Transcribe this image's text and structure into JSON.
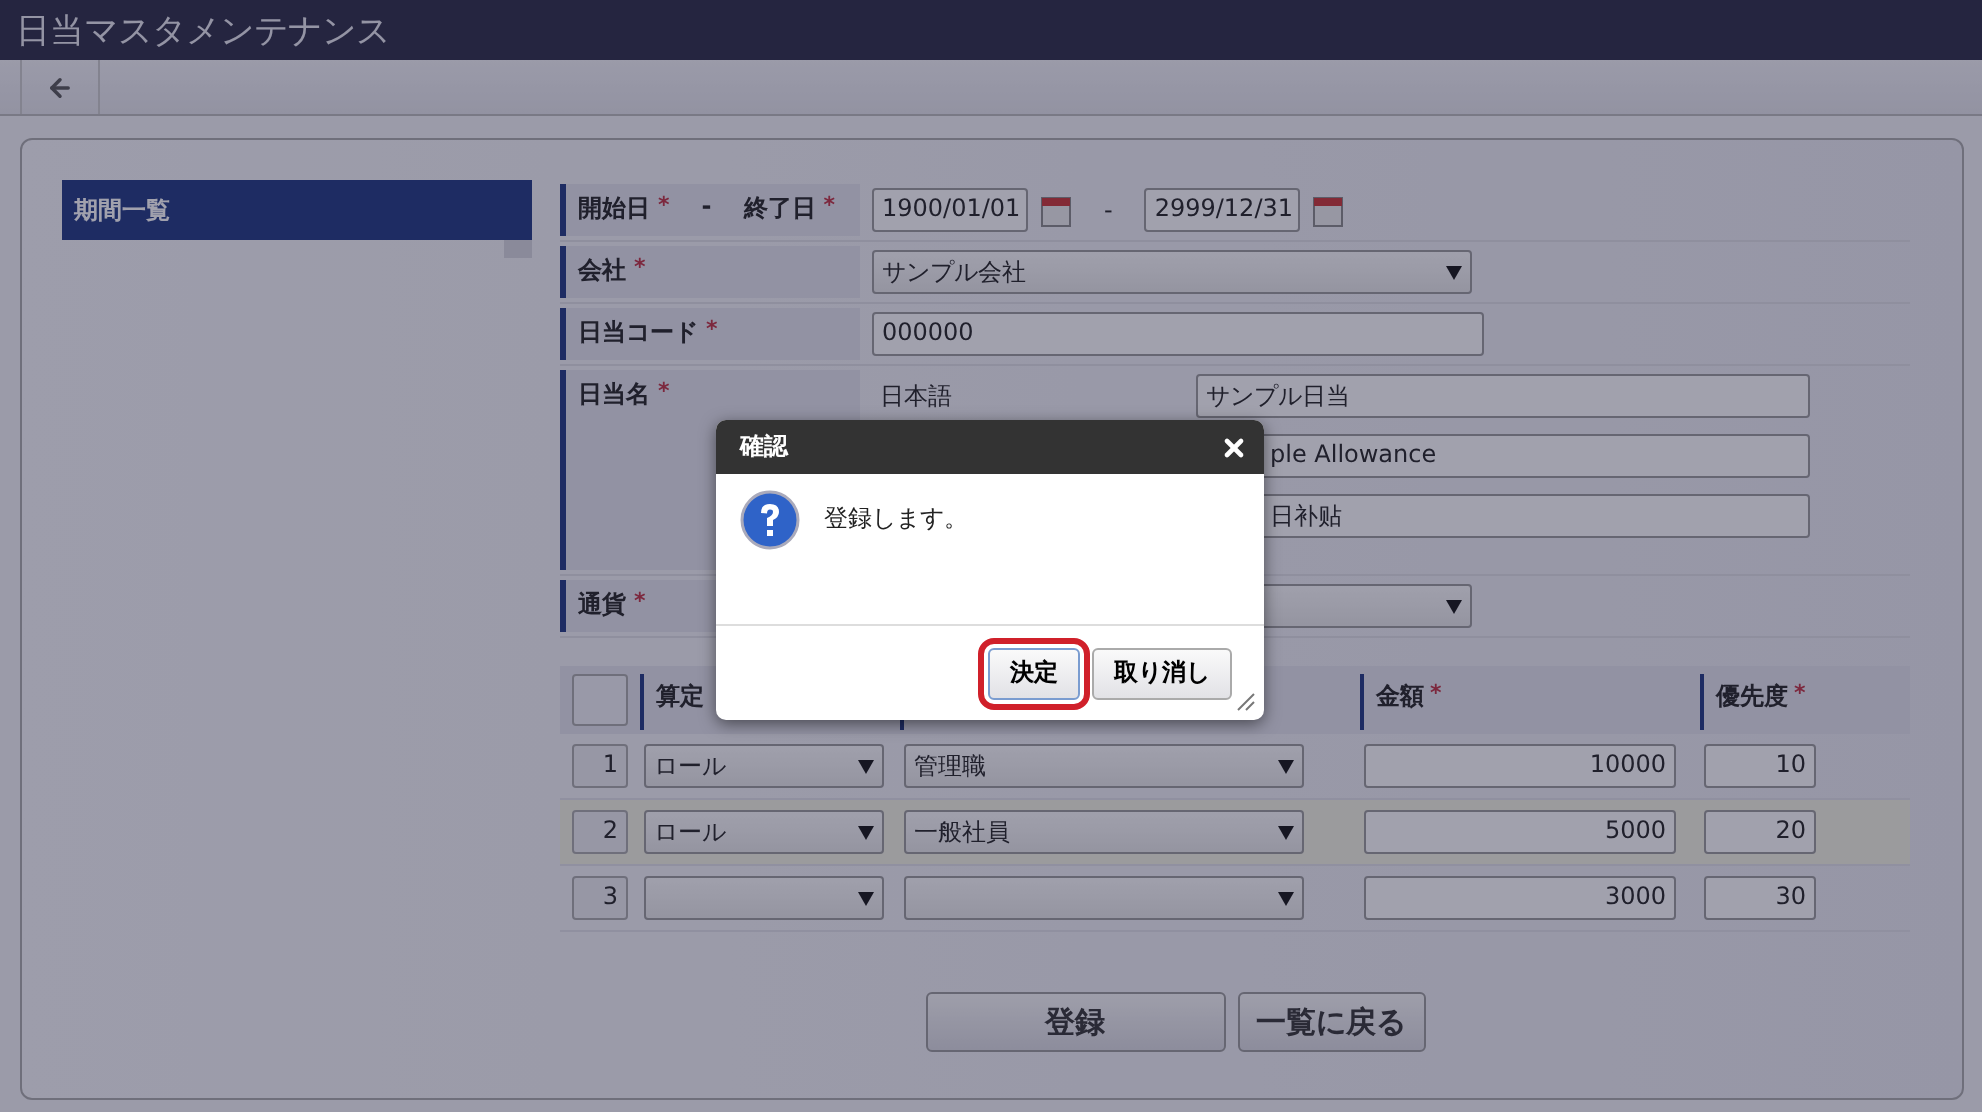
{
  "window": {
    "title": "日当マスタメンテナンス"
  },
  "sidebar": {
    "items": [
      {
        "label": "期間一覧",
        "selected": true
      }
    ]
  },
  "form": {
    "rows": [
      {
        "kind": "date_range",
        "labels": [
          {
            "text": "開始日",
            "mark": "*"
          },
          {
            "text": "終了日",
            "mark": "*"
          }
        ],
        "label_separator": "-",
        "start": "1900/01/01",
        "range_separator": "-",
        "end": "2999/12/31"
      },
      {
        "kind": "select",
        "labels": [
          {
            "text": "会社",
            "mark": "*"
          }
        ],
        "value": "サンプル会社"
      },
      {
        "kind": "text",
        "labels": [
          {
            "text": "日当コード",
            "mark": "*"
          }
        ],
        "value": "000000"
      },
      {
        "kind": "names",
        "labels": [
          {
            "text": "日当名",
            "mark": "*"
          }
        ],
        "names": [
          {
            "language": "日本語",
            "value": "サンプル日当"
          },
          {
            "value": "ple Allowance"
          },
          {
            "value": "日补贴"
          }
        ]
      },
      {
        "kind": "select",
        "labels": [
          {
            "text": "通貨",
            "mark": "*"
          }
        ]
      }
    ]
  },
  "grid": {
    "columns": [
      {
        "kind": "check",
        "checked": false
      },
      {
        "kind": "header",
        "label": "算定"
      },
      {
        "kind": "header"
      },
      {
        "kind": "header",
        "label": "金額",
        "mark": "*"
      },
      {
        "kind": "header",
        "label": "優先度",
        "mark": "*"
      }
    ],
    "rows": [
      {
        "no": "1",
        "basis": "ロール",
        "target": "管理職",
        "amount": "10000",
        "priority": "10",
        "selected": false
      },
      {
        "no": "2",
        "basis": "ロール",
        "target": "一般社員",
        "amount": "5000",
        "priority": "20",
        "selected": true
      },
      {
        "no": "3",
        "amount": "3000",
        "priority": "30",
        "selected": false
      }
    ]
  },
  "buttons": [
    "登録",
    "一覧に戻る"
  ],
  "dialog": {
    "title": "確認",
    "message": "登録します。",
    "buttons": [
      {
        "label": "決定",
        "focused": true
      },
      {
        "label": "取り消し",
        "focused": false
      }
    ]
  }
}
